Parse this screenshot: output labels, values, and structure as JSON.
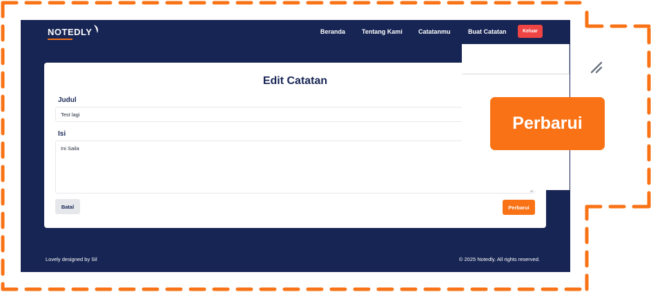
{
  "brand": {
    "name": "NOTEDLY"
  },
  "nav": {
    "links": [
      "Beranda",
      "Tentang Kami",
      "Catatanmu",
      "Buat Catatan"
    ],
    "logout_label": "Keluar"
  },
  "form": {
    "heading": "Edit Catatan",
    "title_label": "Judul",
    "title_value": "Test lagi",
    "content_label": "Isi",
    "content_value": "Ini Saila",
    "cancel_label": "Batal",
    "submit_label": "Perbarui"
  },
  "footer": {
    "left_text": "Lovely designed by Sil",
    "right_text": "© 2025 Notedly. All rights reserved."
  },
  "zoom_callout": {
    "button_label": "Perbarui"
  },
  "colors": {
    "navy": "#172554",
    "accent": "#f97316",
    "danger": "#ef4444",
    "frame_dash": "#f97316"
  },
  "icons": {
    "logo_mark": "leaf-icon",
    "resize_handle": "resize-grip-icon"
  }
}
